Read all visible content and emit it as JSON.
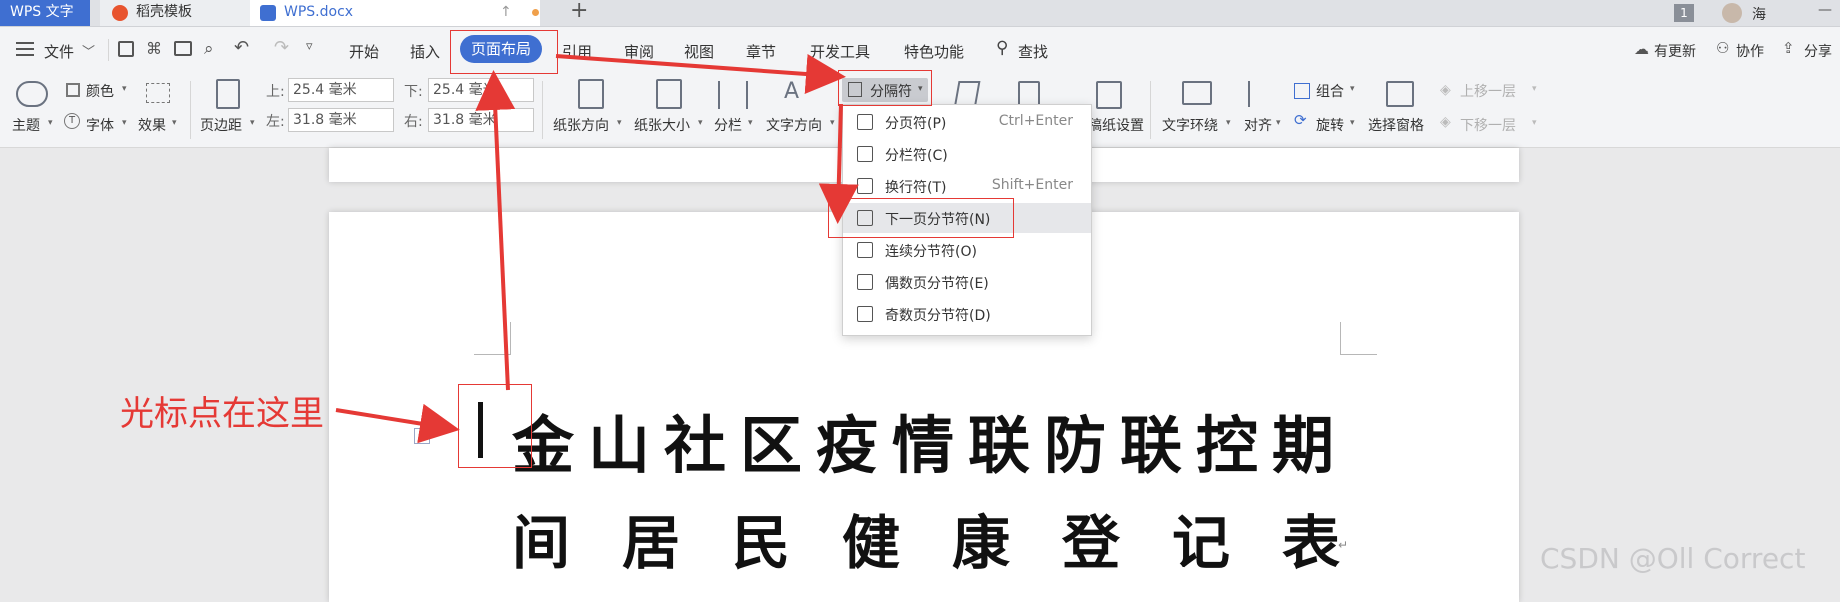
{
  "tabs": {
    "wps": "WPS 文字",
    "daoke": "稻壳模板",
    "doc": "WPS.docx",
    "add": "+"
  },
  "topright": {
    "badge": "1",
    "user": "海",
    "min": "—"
  },
  "menu": {
    "file": "文件",
    "items": [
      "开始",
      "插入",
      "页面布局",
      "引用",
      "审阅",
      "视图",
      "章节",
      "开发工具",
      "特色功能"
    ],
    "search": "查找",
    "update": "有更新",
    "collab": "协作",
    "share": "分享"
  },
  "toolbar": {
    "theme": "主题",
    "color": "颜色",
    "font": "字体",
    "effect": "效果",
    "margin": "页边距",
    "top_label": "上:",
    "top_val": "25.4 毫米",
    "bottom_label": "下:",
    "bottom_val": "25.4 毫米",
    "left_label": "左:",
    "left_val": "31.8 毫米",
    "right_label": "右:",
    "right_val": "31.8 毫米",
    "orientation": "纸张方向",
    "size": "纸张大小",
    "columns": "分栏",
    "textdir": "文字方向",
    "separator": "分隔符",
    "grid": "稿纸设置",
    "wrap": "文字环绕",
    "align": "对齐",
    "group": "组合",
    "rotate": "旋转",
    "selpane": "选择窗格",
    "up": "上移一层",
    "down": "下移一层"
  },
  "dropdown": [
    {
      "label": "分页符(P)",
      "shortcut": "Ctrl+Enter"
    },
    {
      "label": "分栏符(C)",
      "shortcut": ""
    },
    {
      "label": "换行符(T)",
      "shortcut": "Shift+Enter"
    },
    {
      "label": "下一页分节符(N)",
      "shortcut": ""
    },
    {
      "label": "连续分节符(O)",
      "shortcut": ""
    },
    {
      "label": "偶数页分节符(E)",
      "shortcut": ""
    },
    {
      "label": "奇数页分节符(D)",
      "shortcut": ""
    }
  ],
  "document": {
    "title_line1": "金山社区疫情联防联控期",
    "title_line2": "间居民健康登记表"
  },
  "annotation": {
    "cursor_note": "光标点在这里"
  },
  "watermark": "CSDN @Oll Correct",
  "colors": {
    "accent": "#3f6fd1",
    "annotation_red": "#e53935",
    "active_tab_bg": "#3f6fd1"
  }
}
